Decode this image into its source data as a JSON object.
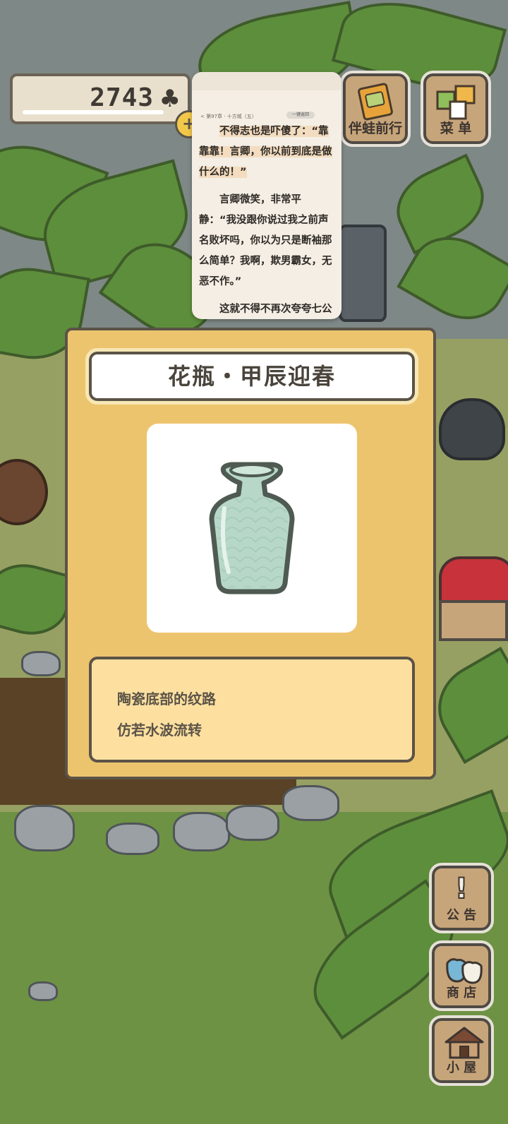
{
  "header": {
    "clover_count": "2743",
    "clover_symbol": "♣",
    "add_symbol": "+",
    "buttons": [
      {
        "label": "伴蛙前行"
      },
      {
        "label": "菜 单"
      }
    ]
  },
  "reader": {
    "chapter": "< 第97章 · 十方城（五）",
    "pill": "一键返回",
    "paragraphs": [
      "不得志也是吓傻了：“靠靠靠！言卿，你以前到底是做什么的！”",
      "言卿微笑，非常平静：“我没跟你说过我之前声名败坏吗，你以为只是断袖那么简单？我啊，欺男霸女，无恶不作。”",
      "这就不得不再次夸夸七公"
    ]
  },
  "dialog": {
    "title": "花瓶・甲辰迎春",
    "description": [
      "陶瓷底部的纹路",
      "仿若水波流转"
    ]
  },
  "side_buttons": [
    {
      "label": "公 告",
      "icon": "exclamation-icon"
    },
    {
      "label": "商 店",
      "icon": "bags-icon"
    },
    {
      "label": "小 屋",
      "icon": "house-icon"
    }
  ],
  "colors": {
    "dialog_bg": "#edc46e",
    "desc_bg": "#fde0a0",
    "button_wood": "#c7a57a",
    "vase": "#b7d8c8"
  }
}
